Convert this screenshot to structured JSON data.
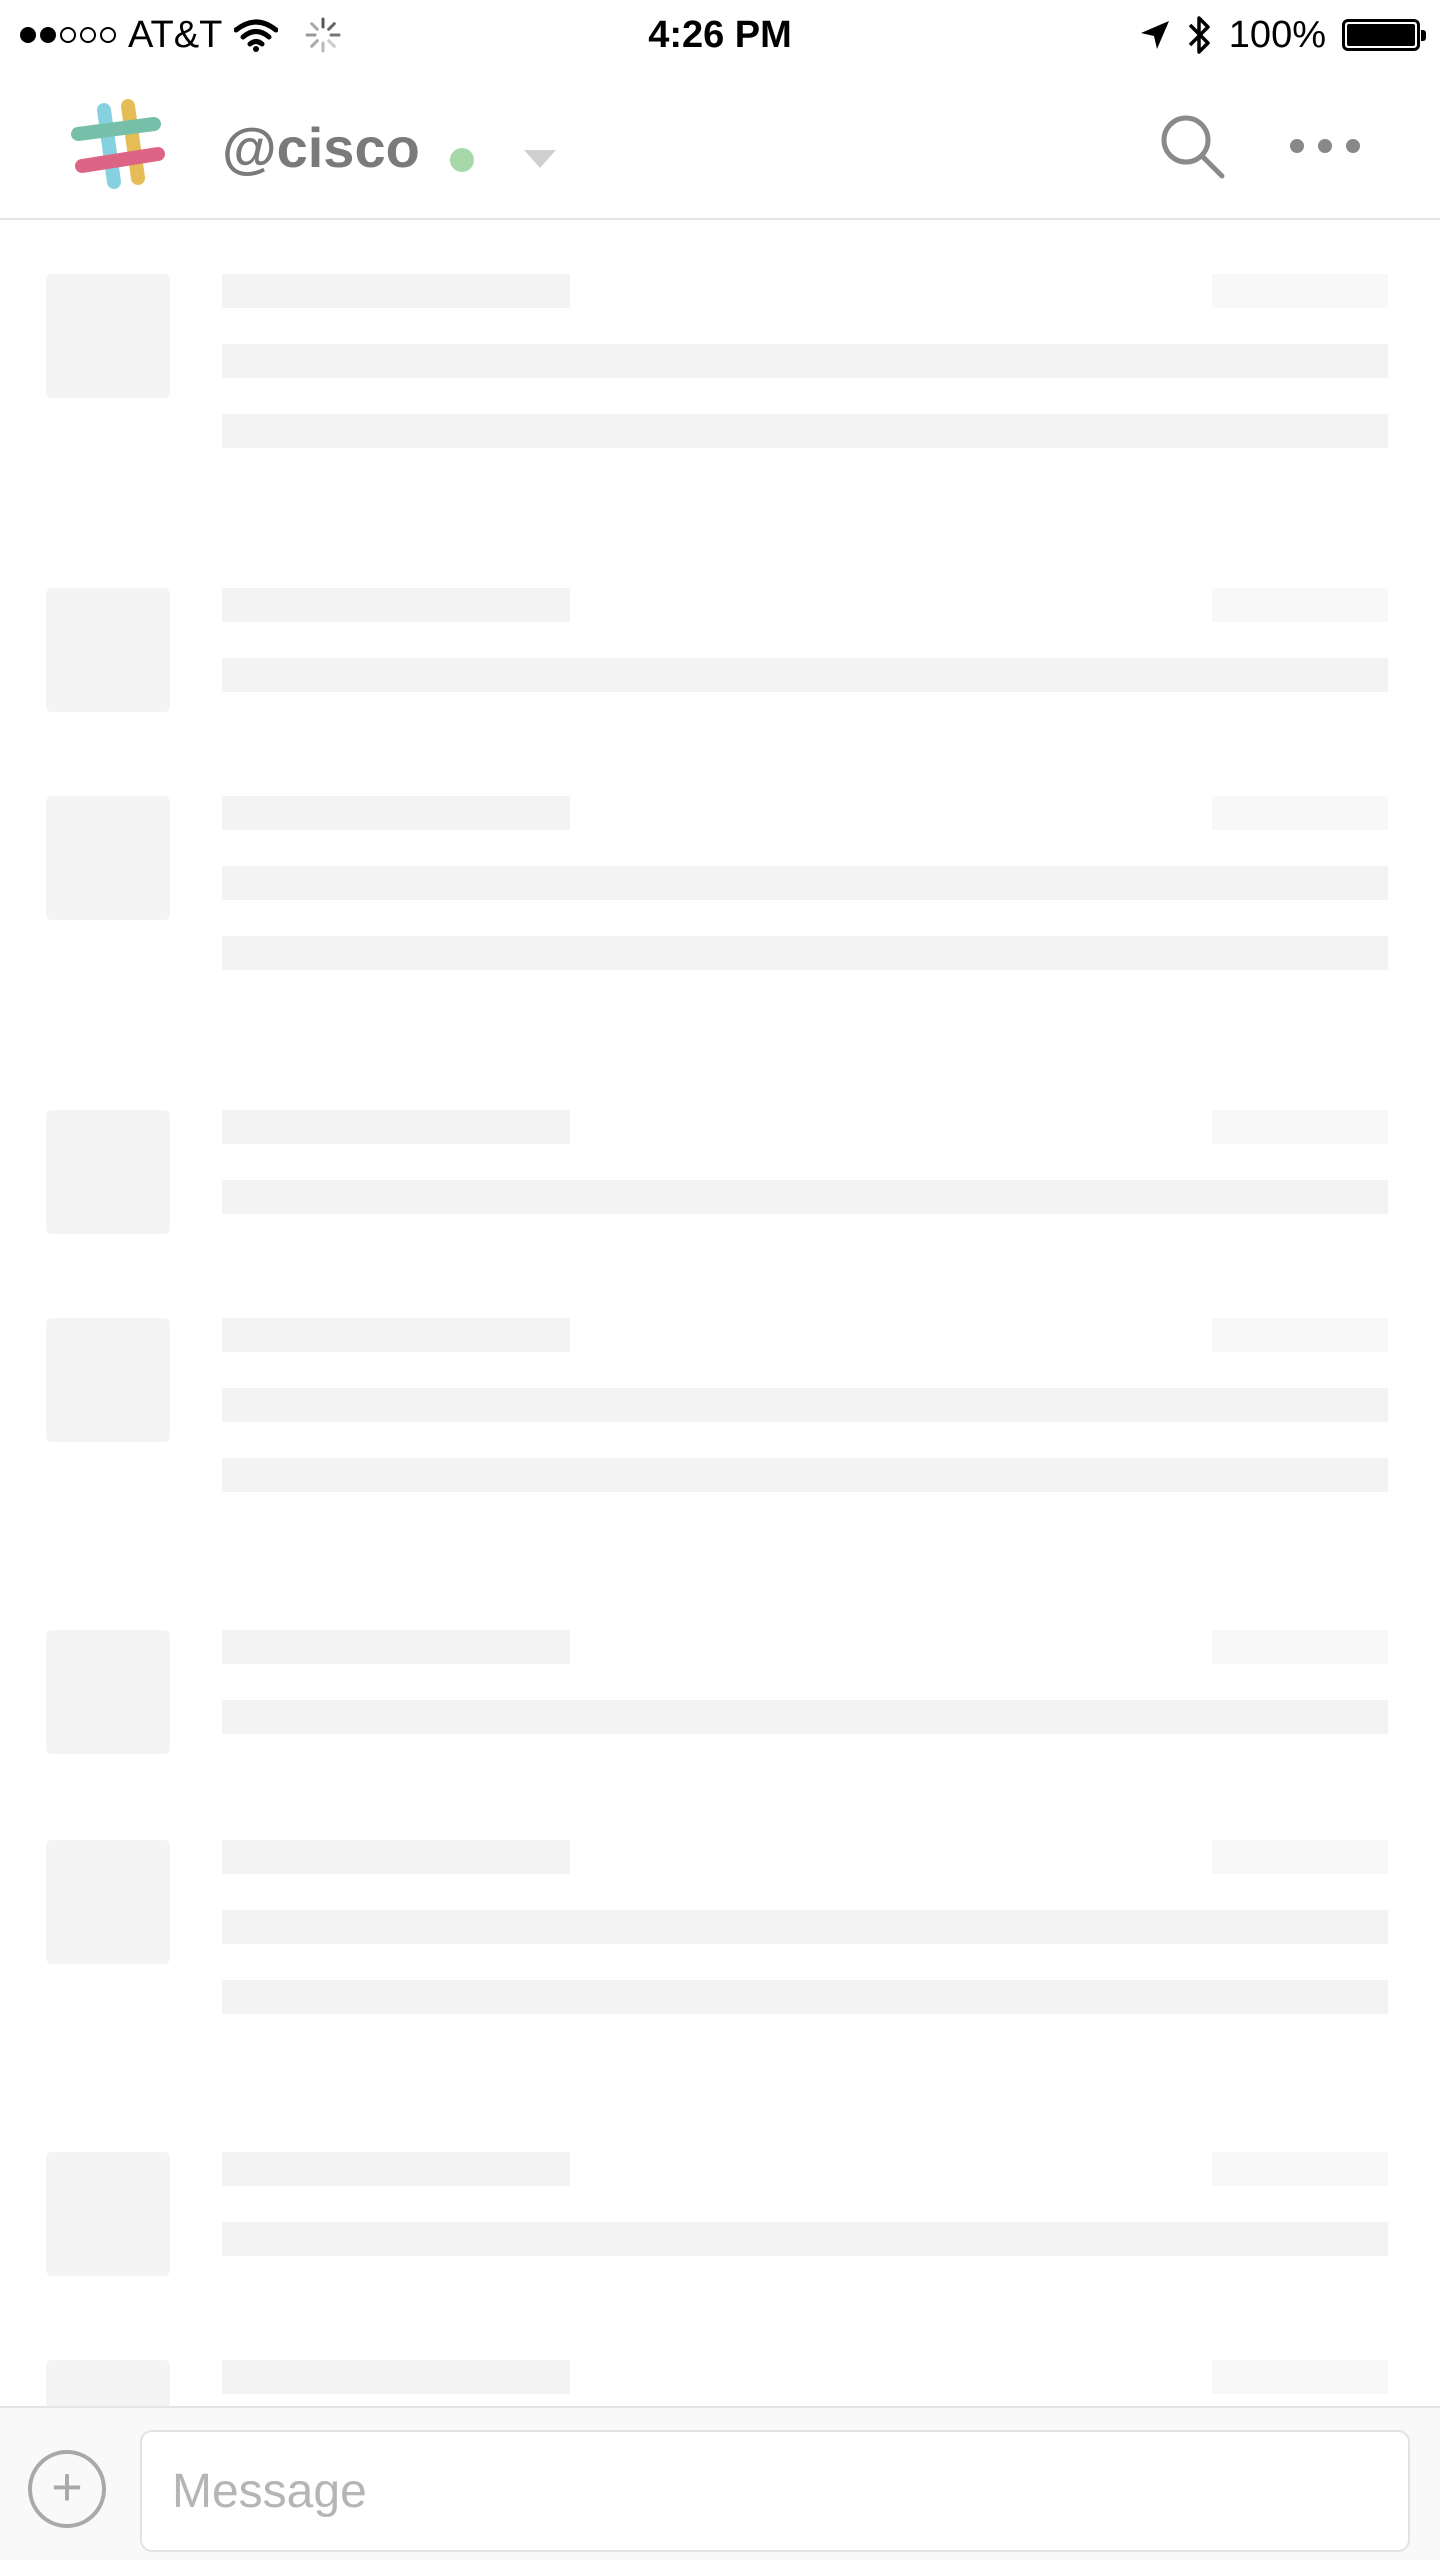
{
  "status_bar": {
    "carrier": "AT&T",
    "time": "4:26 PM",
    "battery": "100%",
    "battery_level": 1.0
  },
  "header": {
    "team_name": "@cisco",
    "presence_color": "#a8d8a8"
  },
  "composer": {
    "attach_label": "+",
    "placeholder": "Message"
  },
  "colors": {
    "skeleton": "#f3f3f3",
    "divider": "#e6e6e6"
  },
  "icons": [
    "slack-logo-icon",
    "wifi-icon",
    "loading-spinner-icon",
    "location-arrow-icon",
    "bluetooth-icon",
    "battery-icon",
    "search-icon",
    "more-icon",
    "plus-icon"
  ]
}
